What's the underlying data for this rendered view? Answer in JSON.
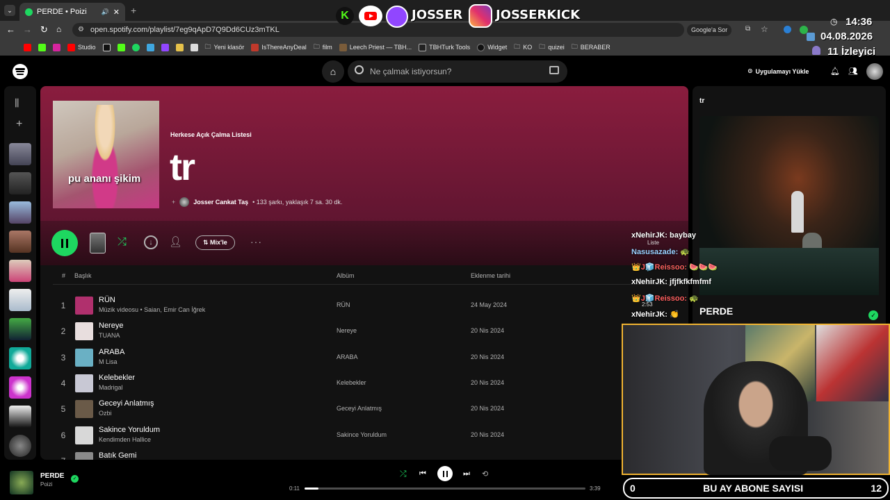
{
  "browser": {
    "tab_title": "PERDE • Poizi",
    "url": "open.spotify.com/playlist/7eg9qApD7Q9Dd6CUz3mTKL",
    "google_btn": "Google'a Sor",
    "bookmarks": [
      "Studio",
      "Yeni klasör",
      "IsThereAnyDeal",
      "film",
      "Leech Priest — TBH...",
      "TBHTurk Tools",
      "Widget",
      "KO",
      "quizei",
      "BERABER"
    ]
  },
  "stream_overlay": {
    "brand1": "JOSSER",
    "brand2": "JOSSERKICK",
    "time": "14:36",
    "date": "04.08.2026",
    "viewers": "11 İzleyici",
    "sub_count_left": "0",
    "sub_label": "BU AY ABONE SAYISI",
    "sub_count_right": "12",
    "chat": [
      {
        "user": "xNehirJK:",
        "msg": "baybay",
        "color": "#ffffff"
      },
      {
        "user": "Nasusazade:",
        "msg": "🐢",
        "color": "#9ad0ff"
      },
      {
        "user": "👑J🧊Reissoo:",
        "msg": "🍉🍉🍉",
        "color": "#ff5f5f"
      },
      {
        "user": "xNehirJK:",
        "msg": "jfjfkfkfmfmf",
        "color": "#ffffff"
      },
      {
        "user": "👑J🧊Reissoo:",
        "msg": "🐢",
        "color": "#ff5f5f"
      },
      {
        "user": "xNehirJK:",
        "msg": "👏",
        "color": "#ffffff"
      }
    ]
  },
  "spotify": {
    "search_placeholder": "Ne çalmak istiyorsun?",
    "install_app": "Uygulamayı Yükle",
    "playlist": {
      "type": "Herkese Açık Çalma Listesi",
      "title": "tr",
      "cover_text": "pu ananı şikim",
      "owner": "Josser Cankat Taş",
      "meta": "• 133 şarkı, yaklaşık 7 sa. 30 dk."
    },
    "mix_label": "Mix'le",
    "columns": {
      "num": "#",
      "title": "Başlık",
      "album": "Albüm",
      "date": "Eklenme tarihi"
    },
    "tracks": [
      {
        "n": "1",
        "title": "RÜN",
        "artist": "Müzik videosu • Saian, Emir Can İğrek",
        "album": "RÜN",
        "date": "24 May 2024",
        "color": "#b0306d"
      },
      {
        "n": "2",
        "title": "Nereye",
        "artist": "TUANA",
        "album": "Nereye",
        "date": "20 Nis 2024",
        "color": "#e8dede"
      },
      {
        "n": "3",
        "title": "ARABA",
        "artist": "M Lisa",
        "album": "ARABA",
        "date": "20 Nis 2024",
        "color": "#6ab0c4"
      },
      {
        "n": "4",
        "title": "Kelebekler",
        "artist": "Madrigal",
        "album": "Kelebekler",
        "date": "20 Nis 2024",
        "color": "#c8c8d4"
      },
      {
        "n": "5",
        "title": "Geceyi Anlatmış",
        "artist": "Ozbi",
        "album": "Geceyi Anlatmış",
        "date": "20 Nis 2024",
        "color": "#6a5a48"
      },
      {
        "n": "6",
        "title": "Sakince Yoruldum",
        "artist": "Kendimden Hallice",
        "album": "Sakince Yoruldum",
        "date": "20 Nis 2024",
        "color": "#d8d8d8"
      },
      {
        "n": "7",
        "title": "Batık Gemi",
        "artist": "",
        "album": "",
        "date": "",
        "color": "#8a8a8a"
      }
    ],
    "right_panel": {
      "title": "tr",
      "song": "PERDE",
      "artist": "Poizi",
      "queue_label": "Liste",
      "duration_small": "2:53"
    },
    "now_playing": {
      "title": "PERDE",
      "artist": "Poizi",
      "elapsed": "0:11",
      "total": "3:39",
      "progress": 0.05
    }
  }
}
